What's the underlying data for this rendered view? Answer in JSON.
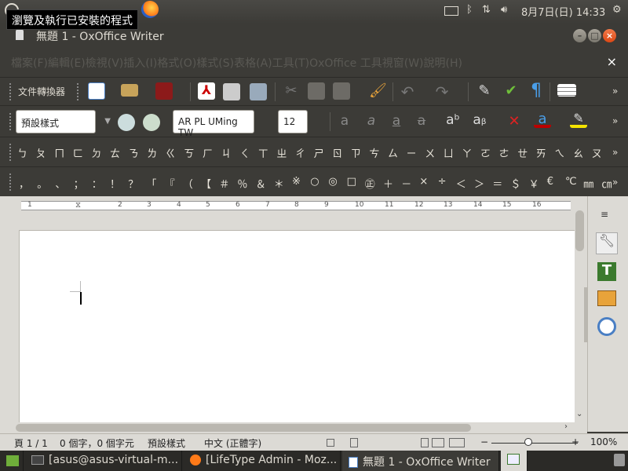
{
  "tooltip": "瀏覽及執行已安裝的程式",
  "topbar": {
    "date": "8月7日(日) 14:33"
  },
  "window": {
    "title": "無題 1 - OxOffice Writer"
  },
  "menu": [
    "檔案(F)",
    "編輯(E)",
    "檢視(V)",
    "插入(I)",
    "格式(O)",
    "樣式(S)",
    "表格(A)",
    "工具(T)",
    "OxOffice 工具視窗(W)",
    "說明(H)"
  ],
  "menu_close": "×",
  "toolbar": {
    "converter_label": "文件轉換器"
  },
  "format": {
    "style": "預設樣式",
    "font": "AR PL UMing TW",
    "size": "12"
  },
  "zhuyin": [
    "ㄅ",
    "ㄆ",
    "ㄇ",
    "ㄈ",
    "ㄉ",
    "ㄊ",
    "ㄋ",
    "ㄌ",
    "ㄍ",
    "ㄎ",
    "ㄏ",
    "ㄐ",
    "ㄑ",
    "ㄒ",
    "ㄓ",
    "ㄔ",
    "ㄕ",
    "ㄖ",
    "ㄗ",
    "ㄘ",
    "ㄙ",
    "ㄧ",
    "ㄨ",
    "ㄩ",
    "ㄚ",
    "ㄛ",
    "ㄜ",
    "ㄝ",
    "ㄞ",
    "ㄟ",
    "ㄠ",
    "ㄡ"
  ],
  "punct": [
    "，",
    "。",
    "、",
    "；",
    "：",
    "！",
    "？",
    "「",
    "『",
    "（",
    "【",
    "＃",
    "％",
    "＆",
    "＊",
    "※",
    "○",
    "◎",
    "□",
    "㊣",
    "＋",
    "－",
    "×",
    "÷",
    "＜",
    "＞",
    "＝",
    "＄",
    "￥",
    "€",
    "℃",
    "㎜",
    "㎝"
  ],
  "ruler": [
    "1",
    "1",
    "2",
    "3",
    "4",
    "5",
    "6",
    "7",
    "8",
    "9",
    "10",
    "11",
    "12",
    "13",
    "14",
    "15",
    "16"
  ],
  "status": {
    "page": "頁 1 / 1",
    "words": "0 個字，0 個字元",
    "style": "預設樣式",
    "lang": "中文 (正體字)",
    "zoom": "100%"
  },
  "taskbar": {
    "terminal": "[asus@asus-virtual-m...",
    "firefox": "[LifeType Admin - Moz...",
    "writer": "無題 1 - OxOffice Writer"
  }
}
